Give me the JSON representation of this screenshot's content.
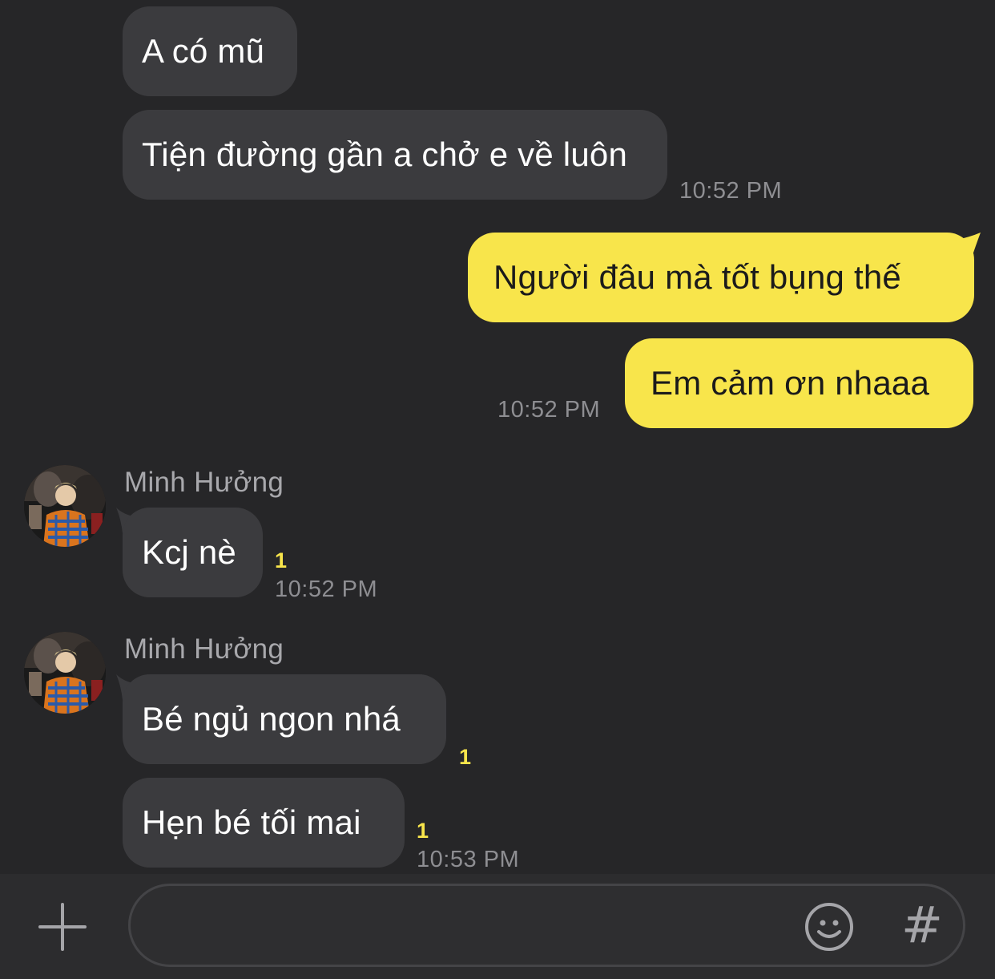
{
  "messages": [
    {
      "text": "A có mũ"
    },
    {
      "text": "Tiện đường gần a chở e về luôn",
      "time": "10:52 PM"
    },
    {
      "text": "Người đâu mà tốt bụng thế"
    },
    {
      "text": "Em cảm ơn nhaaa",
      "time": "10:52 PM"
    },
    {
      "sender": "Minh Hưởng",
      "text": "Kcj nè",
      "unread": "1",
      "time": "10:52 PM"
    },
    {
      "sender": "Minh Hưởng",
      "text": "Bé ngủ ngon nhá",
      "unread": "1"
    },
    {
      "text": "Hẹn bé tối mai",
      "unread": "1",
      "time": "10:53 PM"
    }
  ],
  "composer": {
    "add_icon": "plus-icon",
    "emoji_icon": "emoji-icon",
    "hashtag_label": "#",
    "hashtag_icon": "hashtag-icon"
  },
  "colors": {
    "background": "#262628",
    "incoming_bubble": "#3b3b3e",
    "outgoing_bubble": "#f8e54b",
    "unread_badge": "#f8e54b"
  }
}
